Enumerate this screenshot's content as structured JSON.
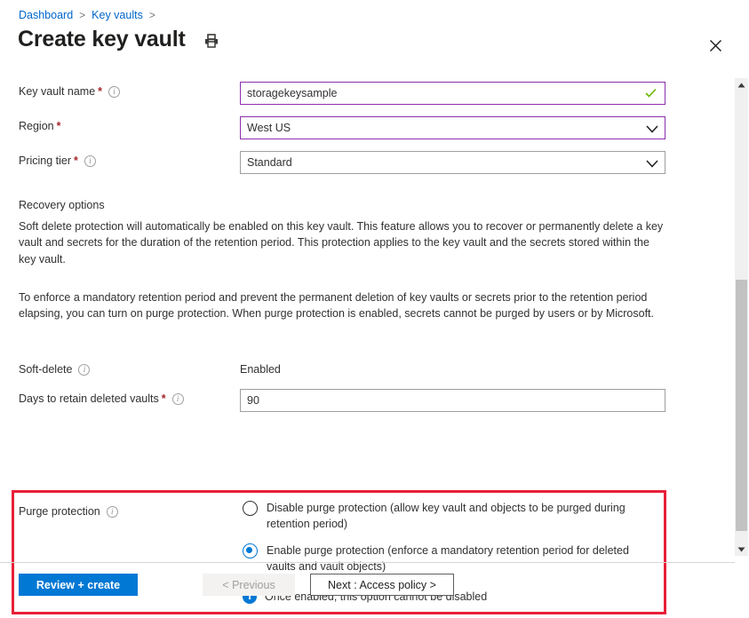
{
  "breadcrumb": {
    "items": [
      "Dashboard",
      "Key vaults"
    ],
    "separator": ">"
  },
  "header": {
    "title": "Create key vault",
    "print_icon": "printer-icon",
    "close_icon": "close-icon"
  },
  "form": {
    "fields": [
      {
        "label": "Key vault name",
        "required": "*",
        "has_info": true,
        "value": "storagekeysample",
        "control": "textbox",
        "state": "focused",
        "adornment": "green-check-icon"
      },
      {
        "label": "Region",
        "required": "*",
        "has_info": false,
        "value": "West US",
        "control": "dropdown",
        "state": "focused",
        "adornment": "chevron-down-icon"
      },
      {
        "label": "Pricing tier",
        "required": "*",
        "has_info": true,
        "value": "Standard",
        "control": "dropdown",
        "state": "default",
        "adornment": "chevron-down-icon"
      }
    ]
  },
  "recovery": {
    "section_title": "Recovery options",
    "paragraph_1": "Soft delete protection will automatically be enabled on this key vault. This feature allows you to recover or permanently delete a key vault and secrets for the duration of the retention period. This protection applies to the key vault and the secrets stored within the key vault.",
    "paragraph_2": "To enforce a mandatory retention period and prevent the permanent deletion of key vaults or secrets prior to the retention period elapsing, you can turn on purge protection. When purge protection is enabled, secrets cannot be purged by users or by Microsoft.",
    "soft_delete": {
      "label": "Soft-delete",
      "value": "Enabled"
    },
    "retain_days": {
      "label": "Days to retain deleted vaults",
      "required": "*",
      "value": "90"
    },
    "purge_protection": {
      "label": "Purge protection",
      "highlight_color": "#e81f38",
      "options": [
        {
          "label": "Disable purge protection (allow key vault and objects to be purged during retention period)",
          "selected": false
        },
        {
          "label": "Enable purge protection (enforce a mandatory retention period for deleted vaults and vault objects)",
          "selected": true
        }
      ],
      "note": "Once enabled, this option cannot be disabled",
      "note_icon": "info-filled-icon"
    }
  },
  "footer": {
    "review_create": "Review + create",
    "previous": "< Previous",
    "next": "Next : Access policy >"
  },
  "scrollbar": {
    "up_icon": "triangle-up-icon",
    "down_icon": "triangle-down-icon"
  },
  "colors": {
    "accent": "#0078d4",
    "focus_border": "#8c2fae",
    "highlight": "#e81f38",
    "required": "#a4262c",
    "valid": "#6bb700"
  }
}
